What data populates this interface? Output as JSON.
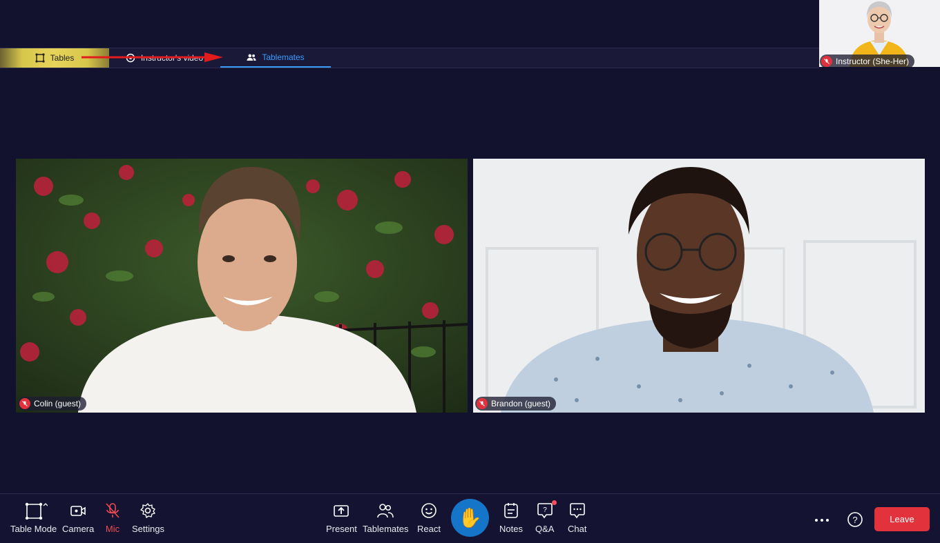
{
  "tabs": [
    {
      "label": "Tables",
      "icon": "frame-icon"
    },
    {
      "label": "Instructor's video",
      "icon": "video-circle-icon"
    },
    {
      "label": "Tablemates",
      "icon": "people-icon"
    }
  ],
  "instructor": {
    "name": "Instructor (She-Her)"
  },
  "participants": [
    {
      "name": "Colin (guest)"
    },
    {
      "name": "Brandon (guest)"
    }
  ],
  "toolbar": {
    "table_mode": "Table Mode",
    "camera": "Camera",
    "mic": "Mic",
    "settings": "Settings",
    "present": "Present",
    "tablemates": "Tablemates",
    "react": "React",
    "notes": "Notes",
    "qa": "Q&A",
    "chat": "Chat",
    "leave": "Leave",
    "raise_hand_icon": "✋"
  },
  "colors": {
    "background": "#12122e",
    "active_tab": "#3b9cff",
    "leave": "#e2333d",
    "raise_hand": "#1475c9",
    "mute": "#e0323c"
  }
}
